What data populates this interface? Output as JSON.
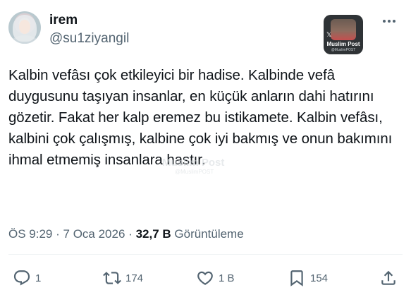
{
  "author": {
    "display_name": "irem",
    "handle": "@su1ziyangil"
  },
  "quote_badge": {
    "title": "Muslim Post",
    "subtitle": "@MuslimPOST",
    "icon": "x-logo-icon"
  },
  "tweet": {
    "text": "Kalbin vefâsı çok etkileyici bir hadise. Kalbinde vefâ duygusunu taşıyan insanlar, en küçük anların dahi hatırını gözetir. Fakat her kalp eremez bu istikamete. Kalbin vefâsı, kalbini çok çalışmış, kalbine çok iyi bakmış ve onun bakımını ihmal etmemiş insanlara hastır."
  },
  "watermark": {
    "title": "Muslim Post",
    "subtitle": "@MuslimPOST"
  },
  "meta": {
    "time": "ÖS 9:29",
    "separator": "·",
    "date": "7 Oca 2026",
    "views_count": "32,7 B",
    "views_label": "Görüntüleme"
  },
  "actions": {
    "reply": {
      "icon": "reply-icon",
      "count": "1"
    },
    "repost": {
      "icon": "repost-icon",
      "count": "174"
    },
    "like": {
      "icon": "heart-icon",
      "count": "1 B"
    },
    "bookmark": {
      "icon": "bookmark-icon",
      "count": "154"
    },
    "share": {
      "icon": "share-icon"
    }
  },
  "colors": {
    "text_primary": "#0f1419",
    "text_secondary": "#536471",
    "divider": "#eff3f4",
    "background": "#ffffff"
  }
}
